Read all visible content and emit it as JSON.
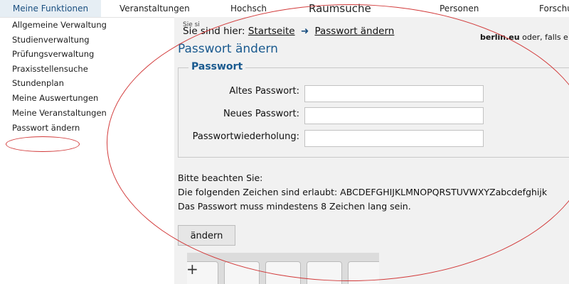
{
  "nav": {
    "tabs": [
      {
        "label": "Meine Funktionen"
      },
      {
        "label": "Veranstaltungen"
      },
      {
        "label": "Hochsch"
      },
      {
        "label": "Raumsuche"
      },
      {
        "label": "Personen"
      },
      {
        "label": "Forschu"
      }
    ]
  },
  "sidebar": {
    "items": [
      {
        "label": "Allgemeine Verwaltung"
      },
      {
        "label": "Studienverwaltung"
      },
      {
        "label": "Prüfungsverwaltung"
      },
      {
        "label": "Praxisstellensuche"
      },
      {
        "label": "Stundenplan"
      },
      {
        "label": "Meine Auswertungen"
      },
      {
        "label": "Meine Veranstaltungen"
      },
      {
        "label": "Passwort ändern"
      }
    ]
  },
  "content": {
    "peek_text": "Sie si",
    "breadcrumb": {
      "prefix": "Sie sind hier:",
      "home": "Startseite",
      "current": "Passwort ändern"
    },
    "peek_right": {
      "bold": "berlin.eu",
      "rest": " oder, falls e"
    },
    "title": "Passwort ändern",
    "fieldset_legend": "Passwort",
    "fields": [
      {
        "label": "Altes Passwort:",
        "value": ""
      },
      {
        "label": "Neues Passwort:",
        "value": ""
      },
      {
        "label": "Passwortwiederholung:",
        "value": ""
      }
    ],
    "notes": [
      "Bitte beachten Sie:",
      "Die folgenden Zeichen sind erlaubt: ABCDEFGHIJKLMNOPQRSTUVWXYZabcdefghijk",
      "Das Passwort muss mindestens 8 Zeichen lang sein."
    ],
    "submit_label": "ändern"
  },
  "icons": {
    "breadcrumb_arrow": "arrow-right-icon"
  },
  "colors": {
    "accent": "#1a5a8f",
    "annotation": "#d23a3a"
  }
}
